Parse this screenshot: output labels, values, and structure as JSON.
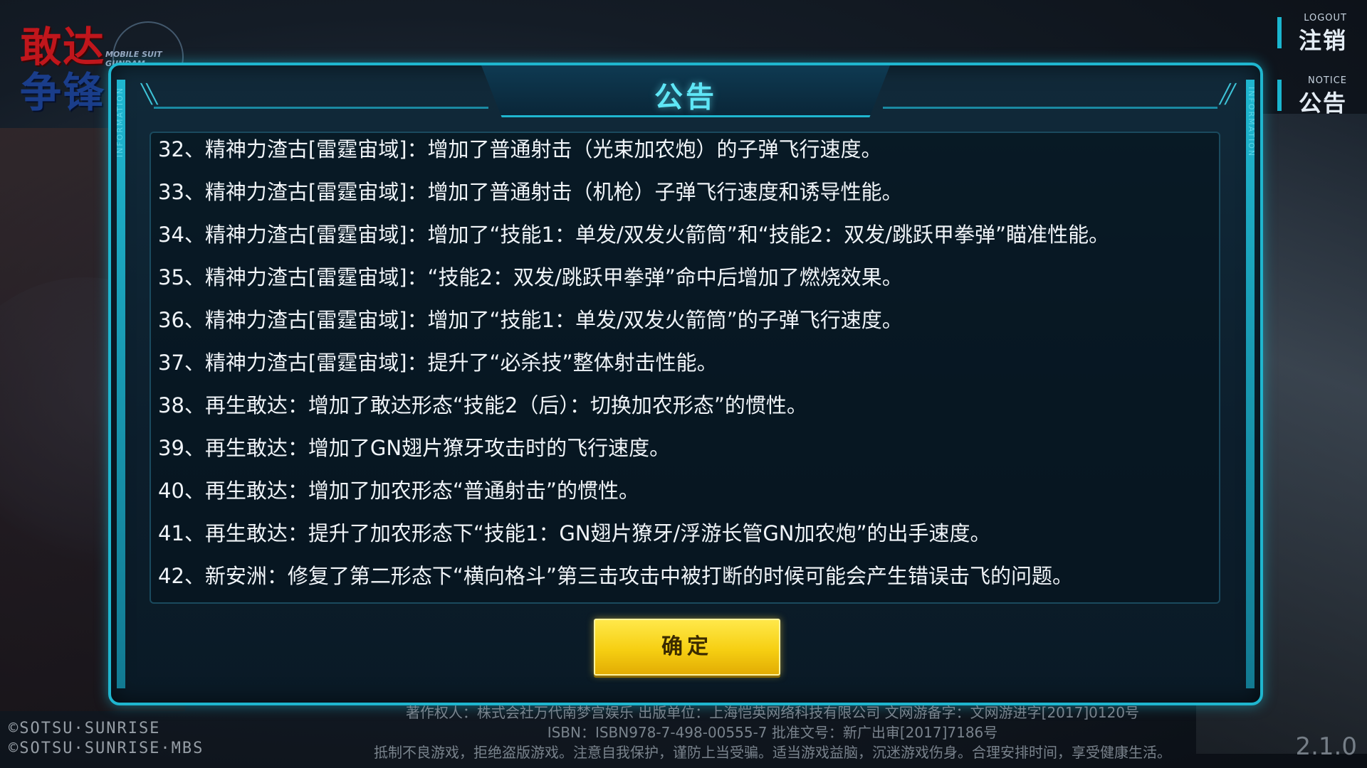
{
  "logo": {
    "cn_top": "敢达",
    "cn_bottom": "争锋",
    "en": "MOBILE SUIT GUNDAM"
  },
  "side_buttons": {
    "logout": {
      "en": "LOGOUT",
      "cn": "注销"
    },
    "notice": {
      "en": "NOTICE",
      "cn": "公告"
    }
  },
  "dialog": {
    "title": "公告",
    "side_label": "INFORMATION",
    "lines": [
      "32、精神力渣古[雷霆宙域]：增加了普通射击（光束加农炮）的子弹飞行速度。",
      "33、精神力渣古[雷霆宙域]：增加了普通射击（机枪）子弹飞行速度和诱导性能。",
      "34、精神力渣古[雷霆宙域]：增加了“技能1：单发/双发火箭筒”和“技能2：双发/跳跃甲拳弹”瞄准性能。",
      "35、精神力渣古[雷霆宙域]：“技能2：双发/跳跃甲拳弹”命中后增加了燃烧效果。",
      "36、精神力渣古[雷霆宙域]：增加了“技能1：单发/双发火箭筒”的子弹飞行速度。",
      "37、精神力渣古[雷霆宙域]：提升了“必杀技”整体射击性能。",
      "38、再生敢达：增加了敢达形态“技能2（后）：切换加农形态”的惯性。",
      "39、再生敢达：增加了GN翅片獠牙攻击时的飞行速度。",
      "40、再生敢达：增加了加农形态“普通射击”的惯性。",
      "41、再生敢达：提升了加农形态下“技能1：GN翅片獠牙/浮游长管GN加农炮”的出手速度。",
      "42、新安洲：修复了第二形态下“横向格斗”第三击攻击中被打断的时候可能会产生错误击飞的问题。"
    ],
    "ok_label": "确定"
  },
  "footer": {
    "copyright1": "©SOTSU·SUNRISE",
    "copyright2": "©SOTSU·SUNRISE·MBS",
    "line1": "著作权人：株式会社万代南梦宫娱乐 出版单位：上海恺英网络科技有限公司 文网游备字：文网游进字[2017]0120号",
    "line2": "ISBN：ISBN978-7-498-00555-7 批准文号：新广出审[2017]7186号",
    "line3": "抵制不良游戏，拒绝盗版游戏。注意自我保护，谨防上当受骗。适当游戏益脑，沉迷游戏伤身。合理安排时间，享受健康生活。",
    "version": "2.1.0"
  }
}
